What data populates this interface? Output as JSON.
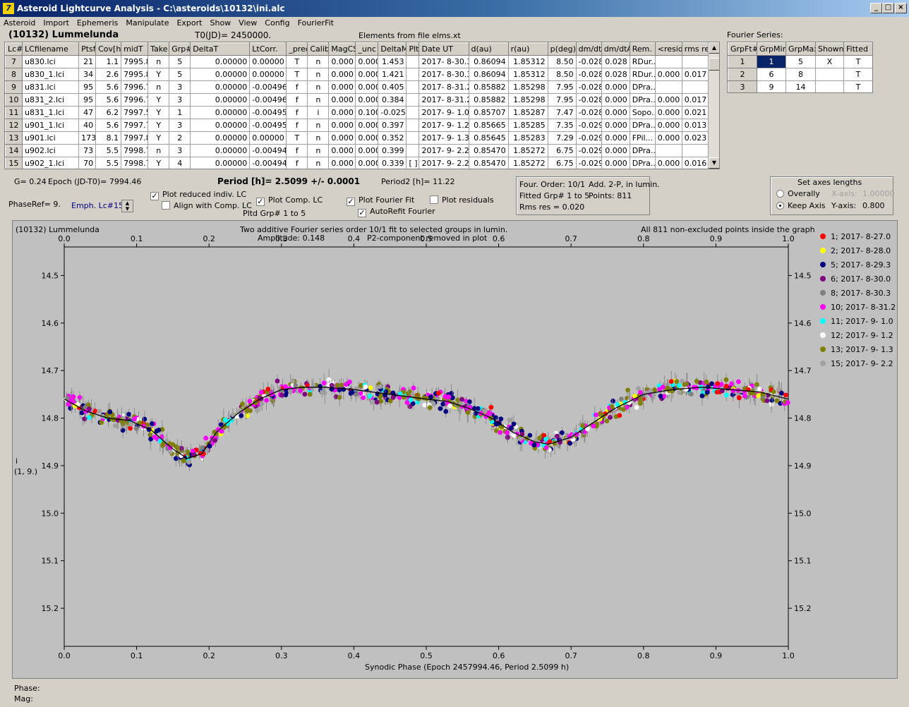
{
  "window": {
    "title": "Asteroid Lightcurve Analysis - C:\\asteroids\\10132\\ini.alc",
    "icon_letter": "7"
  },
  "menu": [
    "Asteroid",
    "Import",
    "Ephemeris",
    "Manipulate",
    "Export",
    "Show",
    "View",
    "Config",
    "FourierFit"
  ],
  "header": {
    "asteroid": "(10132) Lummelunda",
    "t0": "T0(JD)= 2450000.",
    "elements": "Elements from file elms.xt",
    "fourier_label": "Fourier Series:"
  },
  "lc_table": {
    "columns": [
      "Lc#",
      "LCfilename",
      "Ptsf",
      "Cov[h]",
      "midT",
      "Take",
      "Grp#",
      "DeltaT",
      "LtCorr.",
      "_pred.",
      "Calib.",
      "MagCS",
      "_unc",
      "DeltaM",
      "Plt",
      "Date UT",
      "d(au)",
      "r(au)",
      "p(deg)",
      "dm/dt",
      "dm/dtA",
      "Rem.",
      "<resid>",
      "rms res"
    ],
    "rows": [
      [
        "7",
        "u830.lci",
        "21",
        "1.1",
        "7995.8",
        "n",
        "5",
        "0.00000",
        "0.00000",
        "T",
        "n",
        "0.000",
        "0.000",
        "1.453",
        "",
        "2017- 8-30.3",
        "0.86094",
        "1.85312",
        "8.50",
        "-0.028",
        "0.028",
        "RDur...",
        "",
        ""
      ],
      [
        "8",
        "u830_1.lci",
        "34",
        "2.6",
        "7995.8",
        "Y",
        "5",
        "0.00000",
        "0.00000",
        "T",
        "n",
        "0.000",
        "0.000",
        "1.421",
        "",
        "2017- 8-30.3",
        "0.86094",
        "1.85312",
        "8.50",
        "-0.028",
        "0.028",
        "RDur...",
        "0.000",
        "0.017"
      ],
      [
        "9",
        "u831.lci",
        "95",
        "5.6",
        "7996.7",
        "n",
        "3",
        "0.00000",
        "-0.00496",
        "f",
        "n",
        "0.000",
        "0.000",
        "0.405",
        "",
        "2017- 8-31.2",
        "0.85882",
        "1.85298",
        "7.95",
        "-0.028",
        "0.000",
        "DPra...",
        "",
        ""
      ],
      [
        "10",
        "u831_2.lci",
        "95",
        "5.6",
        "7996.7",
        "Y",
        "3",
        "0.00000",
        "-0.00496",
        "f",
        "n",
        "0.000",
        "0.000",
        "0.384",
        "",
        "2017- 8-31.2",
        "0.85882",
        "1.85298",
        "7.95",
        "-0.028",
        "0.000",
        "DPra...",
        "0.000",
        "0.017"
      ],
      [
        "11",
        "u831_1.lci",
        "47",
        "6.2",
        "7997.5",
        "Y",
        "1",
        "0.00000",
        "-0.00495",
        "f",
        "i",
        "0.000",
        "0.100",
        "-0.025",
        "",
        "2017- 9- 1.0",
        "0.85707",
        "1.85287",
        "7.47",
        "-0.028",
        "0.000",
        "Sopo...",
        "0.000",
        "0.021"
      ],
      [
        "12",
        "u901_1.lci",
        "40",
        "5.6",
        "7997.7",
        "Y",
        "3",
        "0.00000",
        "-0.00495",
        "f",
        "n",
        "0.000",
        "0.000",
        "0.397",
        "",
        "2017- 9- 1.2",
        "0.85665",
        "1.85285",
        "7.35",
        "-0.029",
        "0.000",
        "DPra...",
        "0.000",
        "0.013"
      ],
      [
        "13",
        "u901.lci",
        "173",
        "8.1",
        "7997.8",
        "Y",
        "2",
        "0.00000",
        "0.00000",
        "T",
        "n",
        "0.000",
        "0.000",
        "0.352",
        "",
        "2017- 9- 1.3",
        "0.85645",
        "1.85283",
        "7.29",
        "-0.029",
        "0.000",
        "FPil...",
        "0.000",
        "0.023"
      ],
      [
        "14",
        "u902.lci",
        "73",
        "5.5",
        "7998.7",
        "n",
        "3",
        "0.00000",
        "-0.00494",
        "f",
        "n",
        "0.000",
        "0.000",
        "0.399",
        "",
        "2017- 9- 2.2",
        "0.85470",
        "1.85272",
        "6.75",
        "-0.029",
        "0.000",
        "DPra...",
        "",
        ""
      ],
      [
        "15",
        "u902_1.lci",
        "70",
        "5.5",
        "7998.7",
        "Y",
        "4",
        "0.00000",
        "-0.00494",
        "f",
        "n",
        "0.000",
        "0.000",
        "0.339",
        "[ ]",
        "2017- 9- 2.2",
        "0.85470",
        "1.85272",
        "6.75",
        "-0.029",
        "0.000",
        "DPra...",
        "0.000",
        "0.016"
      ]
    ]
  },
  "fourier_table": {
    "columns": [
      "GrpFt#",
      "GrpMin",
      "GrpMax",
      "Shown",
      "Fitted"
    ],
    "rows": [
      [
        "1",
        "1",
        "5",
        "X",
        "T"
      ],
      [
        "2",
        "6",
        "8",
        "",
        "T"
      ],
      [
        "3",
        "9",
        "14",
        "",
        "T"
      ]
    ]
  },
  "info": {
    "g": "G= 0.24",
    "epoch": "Epoch (JD-T0)= 7994.46",
    "period": "Period [h]= 2.5099 +/- 0.0001",
    "period2": "Period2 [h]= 11.22",
    "phase_ref": "PhaseRef= 9.",
    "emph": "Emph. Lc#15:",
    "four_order": "Four. Order: 10/1",
    "add2p": "Add. 2-P, in lumin.",
    "fitted_grp": "Fitted Grp# 1 to 5",
    "points": "Points: 811",
    "rms": "Rms res     = 0.020",
    "pltd_grp": "Pltd Grp#  1   to   5"
  },
  "options": {
    "plot_reduced": {
      "label": "Plot reduced indiv. LC",
      "checked": "✓"
    },
    "align": {
      "label": "Align with Comp. LC",
      "checked": ""
    },
    "plot_comp": {
      "label": "Plot Comp. LC",
      "checked": "✓"
    },
    "plot_fourier": {
      "label": "Plot Fourier Fit",
      "checked": "✓"
    },
    "autorefit": {
      "label": "AutoRefit Fourier",
      "checked": "✓"
    },
    "plot_residuals": {
      "label": "Plot residuals",
      "checked": ""
    }
  },
  "axes_box": {
    "title": "Set axes lengths",
    "overally": "Overally",
    "keep_axis": "Keep Axis",
    "xaxis_label": "X-axis:",
    "xaxis_value": "1.00000",
    "yaxis_label": "Y-axis:",
    "yaxis_value": "0.800"
  },
  "status": {
    "phase": "Phase:",
    "mag": "Mag:"
  },
  "chart_data": {
    "type": "scatter",
    "title": "Two additive Fourier series order 10/1 fit to selected groups in lumin.",
    "subtitle": "Amplitude: 0.148",
    "note": "P2-component removed in plot",
    "left_label": "(10132) Lummelunda",
    "right_label": "All 811 non-excluded points inside the graph",
    "xlabel": "Synodic Phase (Epoch 2457994.46, Period 2.5099 h)",
    "ylabel": "i",
    "ylabel2": "(1, 9.)",
    "xlim": [
      0,
      1
    ],
    "ylim": [
      14.44,
      15.28
    ],
    "y_inverted": true,
    "xticks": [
      "0.0",
      "0.1",
      "0.2",
      "0.3",
      "0.4",
      "0.5",
      "0.6",
      "0.7",
      "0.8",
      "0.9",
      "1.0"
    ],
    "yticks": [
      "14.5",
      "14.6",
      "14.7",
      "14.8",
      "14.9",
      "15.0",
      "15.1",
      "15.2"
    ],
    "fit_curve": {
      "x": [
        0,
        0.03,
        0.06,
        0.09,
        0.12,
        0.15,
        0.17,
        0.19,
        0.21,
        0.24,
        0.27,
        0.3,
        0.33,
        0.36,
        0.4,
        0.45,
        0.5,
        0.53,
        0.56,
        0.59,
        0.62,
        0.65,
        0.67,
        0.7,
        0.73,
        0.76,
        0.8,
        0.84,
        0.88,
        0.92,
        0.96,
        1.0
      ],
      "y": [
        14.76,
        14.785,
        14.8,
        14.805,
        14.825,
        14.865,
        14.885,
        14.875,
        14.83,
        14.79,
        14.76,
        14.74,
        14.735,
        14.735,
        14.74,
        14.75,
        14.76,
        14.765,
        14.78,
        14.8,
        14.83,
        14.85,
        14.855,
        14.84,
        14.81,
        14.78,
        14.75,
        14.74,
        14.735,
        14.74,
        14.745,
        14.76
      ]
    },
    "series": [
      {
        "name": "1; 2017- 8-27.0",
        "color": "#ff0000"
      },
      {
        "name": "2; 2017- 8-28.0",
        "color": "#ffff00"
      },
      {
        "name": "5; 2017- 8-29.3",
        "color": "#000080"
      },
      {
        "name": "6; 2017- 8-30.0",
        "color": "#800080"
      },
      {
        "name": "8; 2017- 8-30.3",
        "color": "#808080"
      },
      {
        "name": "10; 2017- 8-31.2",
        "color": "#ff00ff"
      },
      {
        "name": "11; 2017- 9- 1.0",
        "color": "#00ffff"
      },
      {
        "name": "12; 2017- 9- 1.2",
        "color": "#ffffff"
      },
      {
        "name": "13; 2017- 9- 1.3",
        "color": "#808000"
      },
      {
        "name": "15; 2017- 9- 2.2",
        "color": "#a0a0a0"
      }
    ],
    "points_total": 811
  }
}
